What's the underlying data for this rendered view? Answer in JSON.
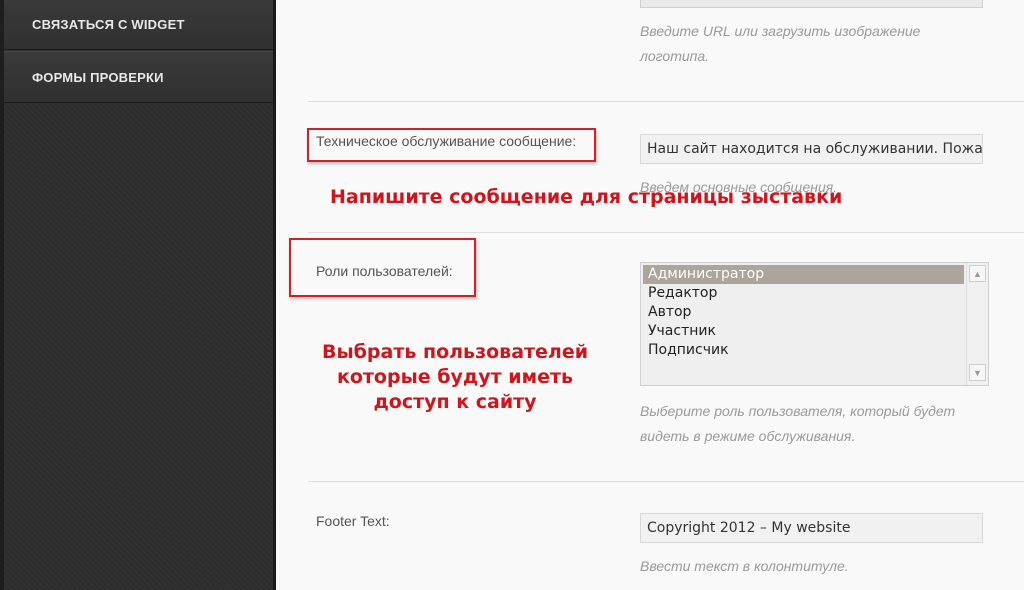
{
  "sidebar": {
    "items": [
      {
        "label": "СВЯЗАТЬСЯ С WIDGET"
      },
      {
        "label": "ФОРМЫ ПРОВЕРКИ"
      }
    ]
  },
  "logo": {
    "hint": "Введите URL или загрузить изображение логотипа."
  },
  "maintenance_message": {
    "label": "Техническое обслуживание сообщение:",
    "value": "Наш сайт находится на обслуживании. Пожалуйста, зайдите позже.",
    "hint": "Введем основные сообщения.",
    "annotation": "Напишите сообщение для страницы зыставки"
  },
  "user_roles": {
    "label": "Роли пользователей:",
    "options": [
      "Администратор",
      "Редактор",
      "Автор",
      "Участник",
      "Подписчик"
    ],
    "selected": "Администратор",
    "hint": "Выберите роль пользователя, который будет видеть в режиме обслуживания.",
    "annotation": [
      "Выбрать пользователей",
      "которые будут иметь",
      "доступ к сайту"
    ]
  },
  "footer_text": {
    "label": "Footer Text:",
    "value": "Copyright 2012 – My website",
    "hint": "Ввести текст в колонтитуле."
  },
  "colors": {
    "accent_red": "#d0141c",
    "sidebar_bg": "#2e2e2e",
    "selection_bg": "#aca59c"
  }
}
